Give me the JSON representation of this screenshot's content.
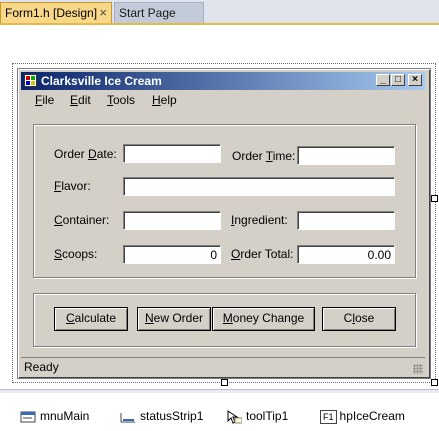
{
  "tabs": [
    {
      "label": "Form1.h [Design]",
      "close": "×"
    },
    {
      "label": "Start Page"
    }
  ],
  "form": {
    "title": "Clarksville Ice Cream",
    "caption_buttons": {
      "minimize": "_",
      "maximize": "□",
      "close": "×"
    },
    "menu": [
      {
        "underline": "F",
        "rest": "ile"
      },
      {
        "underline": "E",
        "rest": "dit"
      },
      {
        "underline": "T",
        "rest": "ools"
      },
      {
        "underline": "H",
        "rest": "elp"
      }
    ],
    "labels": {
      "order_date": {
        "pre": "Order ",
        "u": "D",
        "post": "ate:"
      },
      "order_time": {
        "pre": "Order ",
        "u": "T",
        "post": "ime:"
      },
      "flavor": {
        "pre": "",
        "u": "F",
        "post": "lavor:"
      },
      "container": {
        "pre": "",
        "u": "C",
        "post": "ontainer:"
      },
      "ingredient": {
        "pre": "",
        "u": "I",
        "post": "ngredient:"
      },
      "scoops": {
        "pre": "",
        "u": "S",
        "post": "coops:"
      },
      "order_total": {
        "pre": "",
        "u": "O",
        "post": "rder Total:"
      }
    },
    "fields": {
      "order_date": "",
      "order_time": "",
      "flavor": "",
      "container": "",
      "ingredient": "",
      "scoops": "0",
      "order_total": "0.00"
    },
    "buttons": [
      {
        "pre": "",
        "u": "C",
        "post": "alculate"
      },
      {
        "pre": "",
        "u": "N",
        "post": "ew Order"
      },
      {
        "pre": "",
        "u": "M",
        "post": "oney Change"
      },
      {
        "pre": "C",
        "u": "l",
        "post": "ose"
      }
    ],
    "status": "Ready"
  },
  "tray": [
    {
      "label": "mnuMain",
      "icon": "menu-icon"
    },
    {
      "label": "statusStrip1",
      "icon": "statusstrip-icon"
    },
    {
      "label": "toolTip1",
      "icon": "tooltip-icon"
    },
    {
      "label": "hpIceCream",
      "icon": "helpprovider-icon",
      "badge": "F1"
    }
  ]
}
